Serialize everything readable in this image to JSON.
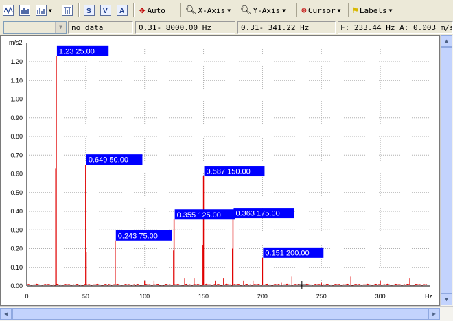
{
  "toolbar": {
    "auto_label": "Auto",
    "xaxis_label": "X-Axis",
    "yaxis_label": "Y-Axis",
    "cursor_label": "Cursor",
    "labels_label": "Labels",
    "icons": [
      "waveform-icon",
      "spectrum-icon",
      "dual-chart-icon",
      "filter-icon",
      "s-scale-icon",
      "v-scale-icon",
      "a-scale-icon"
    ]
  },
  "statusbar": {
    "channel_value": "",
    "no_data": "no data",
    "range_full": "0.31- 8000.00 Hz",
    "range_view": "0.31- 341.22 Hz",
    "cursor_readout": "F: 233.44 Hz  A: 0.003 m/s2"
  },
  "colors": {
    "trace": "#e00000",
    "label_bg": "#0000ff",
    "label_fg": "#ffffff",
    "grid": "#b0b0b0"
  },
  "chart_data": {
    "type": "line",
    "ylabel": "m/s2",
    "xlabel": "Hz",
    "xlim": [
      0,
      341.22
    ],
    "ylim": [
      0,
      1.3
    ],
    "xticks": [
      0,
      50,
      100,
      150,
      200,
      250,
      300
    ],
    "yticks": [
      "0.00",
      "0.10",
      "0.20",
      "0.30",
      "0.40",
      "0.50",
      "0.60",
      "0.70",
      "0.80",
      "0.90",
      "1.00",
      "1.10",
      "1.20"
    ],
    "grid": true,
    "peaks": [
      {
        "x": 25,
        "y": 1.23
      },
      {
        "x": 50,
        "y": 0.649
      },
      {
        "x": 75,
        "y": 0.243
      },
      {
        "x": 125,
        "y": 0.355
      },
      {
        "x": 150,
        "y": 0.587
      },
      {
        "x": 175,
        "y": 0.363
      },
      {
        "x": 200,
        "y": 0.151
      }
    ],
    "minor_peaks": [
      {
        "x": 24.5,
        "y": 0.63
      },
      {
        "x": 50.5,
        "y": 0.18
      },
      {
        "x": 100,
        "y": 0.03
      },
      {
        "x": 108,
        "y": 0.03
      },
      {
        "x": 124.5,
        "y": 0.19
      },
      {
        "x": 134,
        "y": 0.04
      },
      {
        "x": 142,
        "y": 0.04
      },
      {
        "x": 149.5,
        "y": 0.22
      },
      {
        "x": 160,
        "y": 0.03
      },
      {
        "x": 167,
        "y": 0.04
      },
      {
        "x": 174.5,
        "y": 0.2
      },
      {
        "x": 184,
        "y": 0.03
      },
      {
        "x": 192,
        "y": 0.03
      },
      {
        "x": 216,
        "y": 0.02
      },
      {
        "x": 225,
        "y": 0.05
      },
      {
        "x": 250,
        "y": 0.02
      },
      {
        "x": 275,
        "y": 0.05
      },
      {
        "x": 300,
        "y": 0.03
      },
      {
        "x": 325,
        "y": 0.04
      }
    ],
    "peak_labels": [
      {
        "amp": "1.23",
        "freq": "25.00"
      },
      {
        "amp": "0.649",
        "freq": "50.00"
      },
      {
        "amp": "0.243",
        "freq": "75.00"
      },
      {
        "amp": "0.355",
        "freq": "125.00"
      },
      {
        "amp": "0.587",
        "freq": "150.00"
      },
      {
        "amp": "0.363",
        "freq": "175.00"
      },
      {
        "amp": "0.151",
        "freq": "200.00"
      }
    ],
    "cursor": {
      "x": 233.44,
      "y": 0.003
    }
  }
}
